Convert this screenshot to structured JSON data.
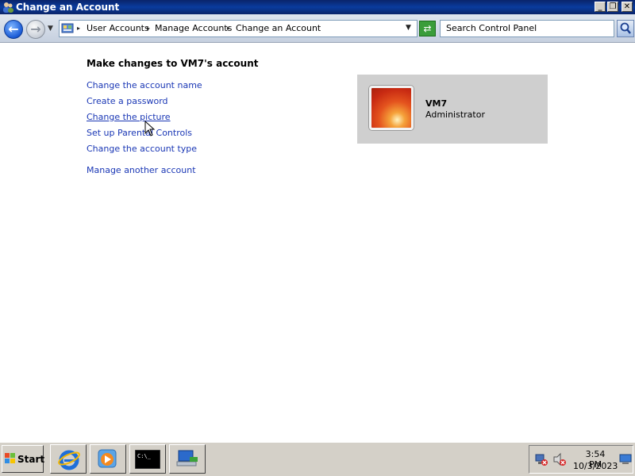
{
  "window": {
    "title": "Change an Account",
    "buttons": {
      "minimize": "_",
      "restore": "❐",
      "close": "✕"
    }
  },
  "address_bar": {
    "breadcrumbs": [
      "User Accounts",
      "Manage Accounts",
      "Change an Account"
    ],
    "search_placeholder": "Search Control Panel"
  },
  "main": {
    "heading": "Make changes to VM7's account",
    "tasks": [
      "Change the account name",
      "Create a password",
      "Change the picture",
      "Set up Parental Controls",
      "Change the account type"
    ],
    "manage_link": "Manage another account"
  },
  "account": {
    "name": "VM7",
    "type": "Administrator"
  },
  "taskbar": {
    "start_label": "Start",
    "quick_launch": [
      "internet-explorer-icon",
      "windows-media-player-icon",
      "command-prompt-icon",
      "network-computer-icon"
    ],
    "clock_time": "3:54 PM",
    "clock_date": "10/3/2023"
  },
  "colors": {
    "title_bar": "#0a246a",
    "link": "#1a37b5",
    "account_tile": "#cfcfcf",
    "taskbar": "#d4d0c8"
  }
}
